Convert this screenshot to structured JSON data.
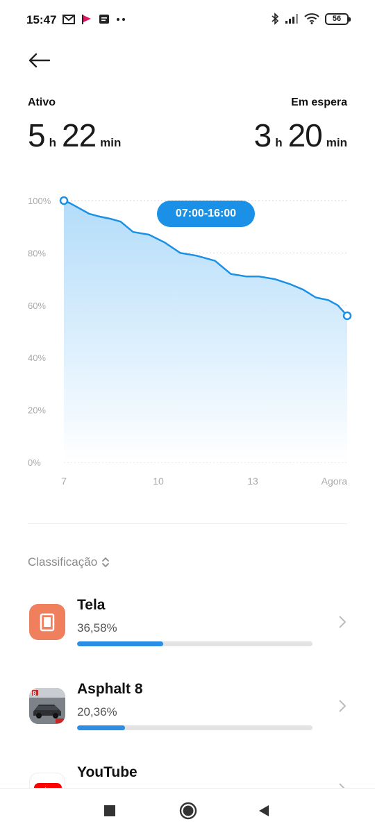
{
  "status_bar": {
    "time": "15:47",
    "battery": "56",
    "left_icons": [
      "gmail-icon",
      "flag-app-icon",
      "message-icon",
      "more-dots-icon"
    ],
    "right_icons": [
      "bluetooth-icon",
      "signal-icon",
      "wifi-icon",
      "battery-icon"
    ]
  },
  "summary": {
    "active_label": "Ativo",
    "active_hours": "5",
    "active_hours_unit": "h",
    "active_minutes": "22",
    "active_minutes_unit": "min",
    "standby_label": "Em espera",
    "standby_hours": "3",
    "standby_hours_unit": "h",
    "standby_minutes": "20",
    "standby_minutes_unit": "min"
  },
  "chart_data": {
    "type": "area",
    "y_ticks": [
      "100%",
      "80%",
      "60%",
      "40%",
      "20%",
      "0%"
    ],
    "x_ticks": [
      "7",
      "10",
      "13",
      "Agora"
    ],
    "x": [
      7.0,
      7.2,
      7.5,
      7.8,
      8.1,
      8.5,
      8.8,
      9.2,
      9.7,
      10.2,
      10.7,
      11.2,
      11.8,
      12.3,
      12.8,
      13.2,
      13.7,
      14.2,
      14.6,
      15.0,
      15.4,
      15.7,
      16.0
    ],
    "values": [
      100,
      99,
      97,
      95,
      94,
      93,
      92,
      88,
      87,
      84,
      80,
      79,
      77,
      72,
      71,
      71,
      70,
      68,
      66,
      63,
      62,
      60,
      56
    ],
    "ylim": [
      0,
      100
    ],
    "xlim": [
      7,
      16
    ],
    "grid": true,
    "color": "#1a91e6",
    "fill_top": "#b3dcfa",
    "fill_bottom": "#ffffff",
    "tooltip": "07:00-16:00"
  },
  "sort": {
    "label": "Classificação"
  },
  "apps": [
    {
      "name": "Tela",
      "percent": "36,58%",
      "share": 0.3658,
      "icon": "screen-icon",
      "icon_color": "#f07f5d"
    },
    {
      "name": "Asphalt 8",
      "percent": "20,36%",
      "share": 0.2036,
      "icon": "asphalt-icon",
      "icon_color": "#555555"
    },
    {
      "name": "YouTube",
      "percent": "",
      "share": 0,
      "icon": "youtube-icon",
      "icon_color": "#ff0000"
    }
  ],
  "nav": [
    "recents-button",
    "home-button",
    "back-nav-button"
  ]
}
